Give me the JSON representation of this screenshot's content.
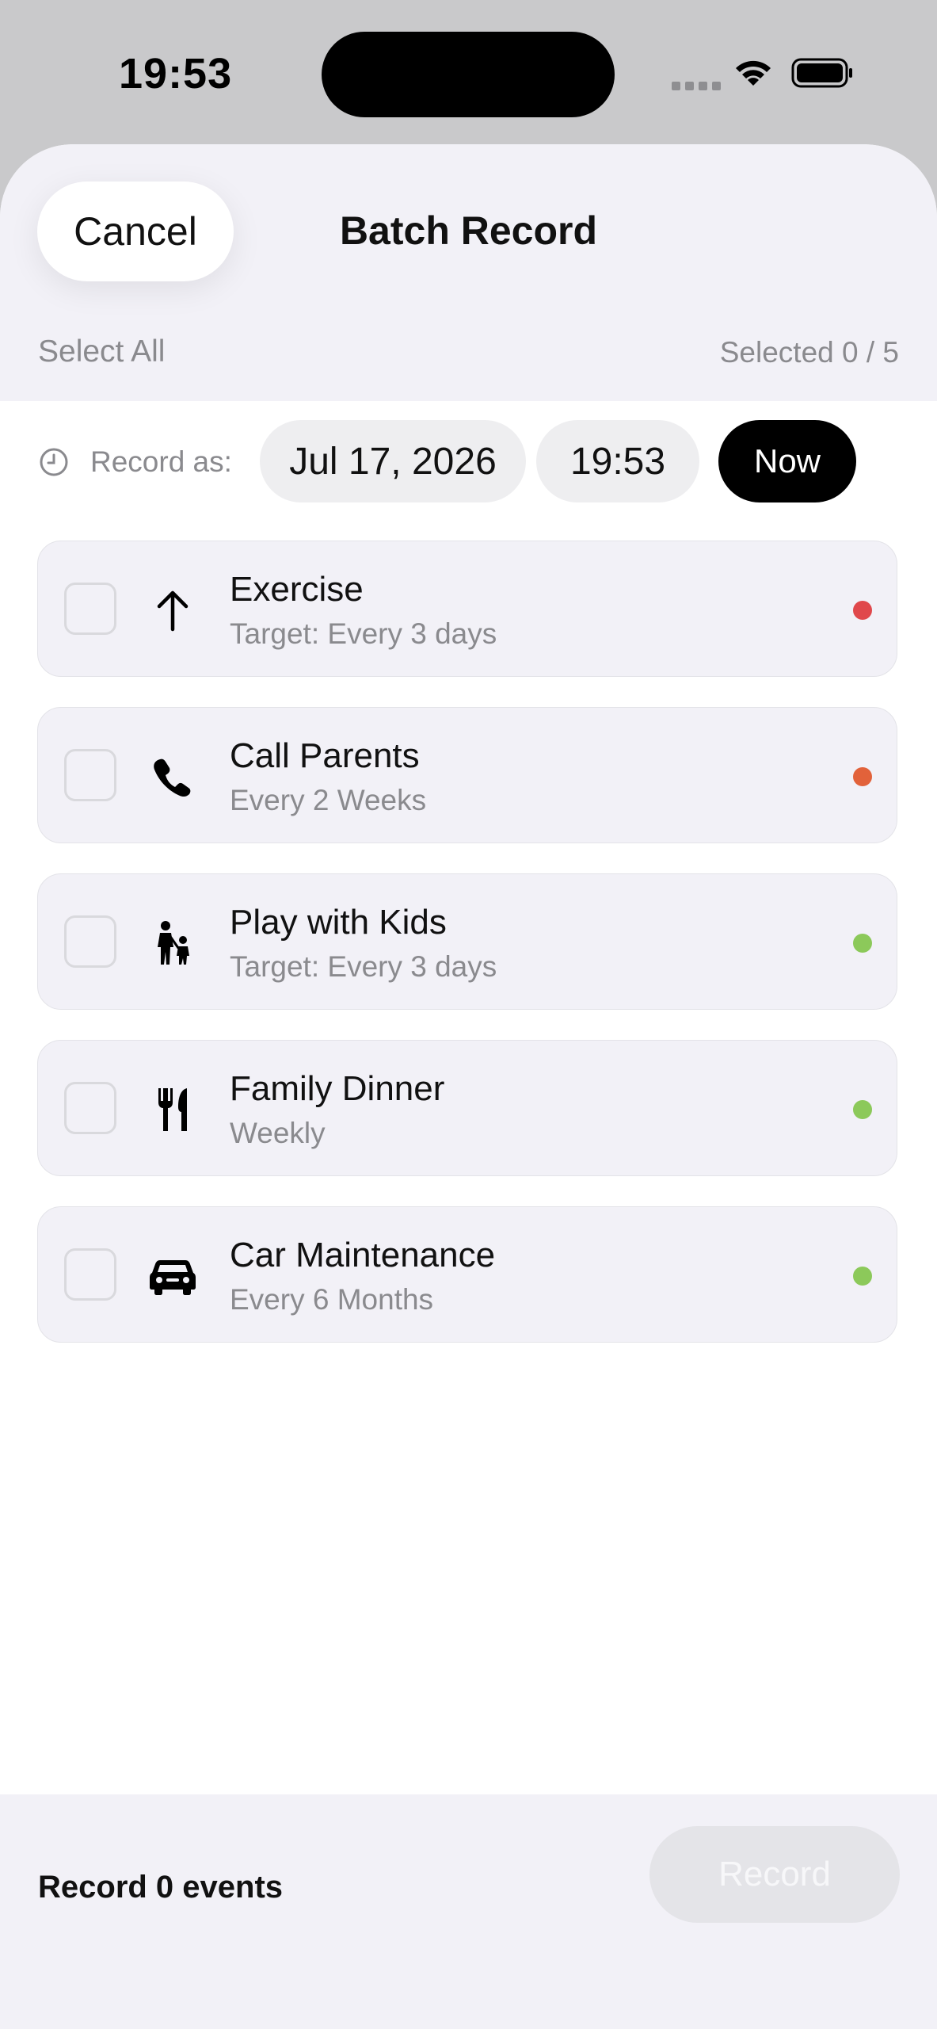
{
  "status_bar": {
    "time": "19:53",
    "signal_icon": "cellular-signal-icon",
    "wifi_icon": "wifi-icon",
    "battery_icon": "battery-icon"
  },
  "header": {
    "cancel_label": "Cancel",
    "title": "Batch Record",
    "select_all_label": "Select All",
    "selected_count": "Selected 0 / 5"
  },
  "record_as": {
    "icon": "clock-icon",
    "label": "Record as:",
    "date": "Jul 17, 2026",
    "time": "19:53",
    "now_label": "Now"
  },
  "items": [
    {
      "title": "Exercise",
      "subtitle": "Target: Every 3 days",
      "icon": "arrow-up-icon",
      "status_color": "#e0484b",
      "checked": false
    },
    {
      "title": "Call Parents",
      "subtitle": "Every 2 Weeks",
      "icon": "phone-icon",
      "status_color": "#e2623a",
      "checked": false
    },
    {
      "title": "Play with Kids",
      "subtitle": "Target: Every 3 days",
      "icon": "parent-child-icon",
      "status_color": "#8cc95a",
      "checked": false
    },
    {
      "title": "Family Dinner",
      "subtitle": "Weekly",
      "icon": "fork-knife-icon",
      "status_color": "#8cc95a",
      "checked": false
    },
    {
      "title": "Car Maintenance",
      "subtitle": "Every 6 Months",
      "icon": "car-icon",
      "status_color": "#8cc95a",
      "checked": false
    }
  ],
  "footer": {
    "summary": "Record 0 events",
    "record_label": "Record"
  }
}
